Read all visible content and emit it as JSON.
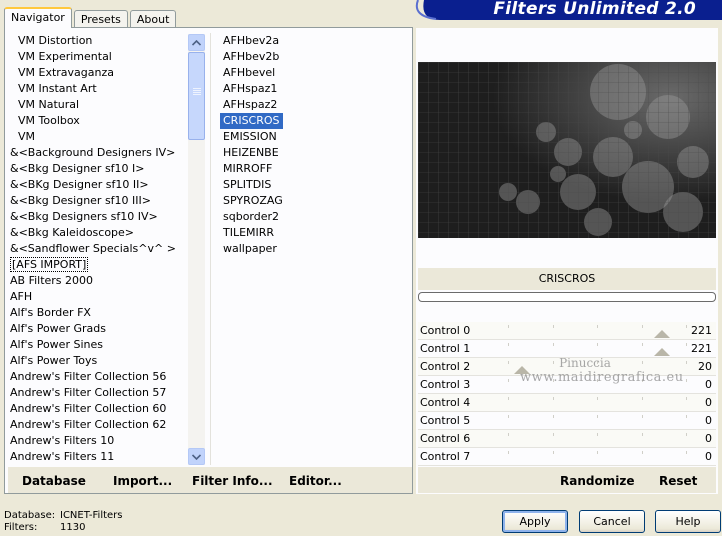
{
  "app": {
    "title": "Filters Unlimited 2.0"
  },
  "tabs": [
    {
      "label": "Navigator",
      "active": true
    },
    {
      "label": "Presets",
      "active": false
    },
    {
      "label": "About",
      "active": false
    }
  ],
  "categories": [
    {
      "label": "VM Distortion",
      "indent": true
    },
    {
      "label": "VM Experimental",
      "indent": true
    },
    {
      "label": "VM Extravaganza",
      "indent": true
    },
    {
      "label": "VM Instant Art",
      "indent": true
    },
    {
      "label": "VM Natural",
      "indent": true
    },
    {
      "label": "VM Toolbox",
      "indent": true
    },
    {
      "label": "VM",
      "indent": true
    },
    {
      "label": "&<Background Designers IV>",
      "indent": false
    },
    {
      "label": "&<Bkg Designer sf10 I>",
      "indent": false
    },
    {
      "label": "&<BKg Designer sf10 II>",
      "indent": false
    },
    {
      "label": "&<Bkg Designer sf10 III>",
      "indent": false
    },
    {
      "label": "&<Bkg Designers sf10 IV>",
      "indent": false
    },
    {
      "label": "&<Bkg Kaleidoscope>",
      "indent": false
    },
    {
      "label": "&<Sandflower Specials^v^ >",
      "indent": false
    },
    {
      "label": "[AFS IMPORT]",
      "indent": false,
      "selected": true
    },
    {
      "label": "AB Filters 2000",
      "indent": false
    },
    {
      "label": "AFH",
      "indent": false
    },
    {
      "label": "Alf's Border FX",
      "indent": false
    },
    {
      "label": "Alf's Power Grads",
      "indent": false
    },
    {
      "label": "Alf's Power Sines",
      "indent": false
    },
    {
      "label": "Alf's Power Toys",
      "indent": false
    },
    {
      "label": "Andrew's Filter Collection 56",
      "indent": false
    },
    {
      "label": "Andrew's Filter Collection 57",
      "indent": false
    },
    {
      "label": "Andrew's Filter Collection 60",
      "indent": false
    },
    {
      "label": "Andrew's Filter Collection 62",
      "indent": false
    },
    {
      "label": "Andrew's Filters 10",
      "indent": false
    },
    {
      "label": "Andrew's Filters 11",
      "indent": false
    }
  ],
  "filters": [
    {
      "label": "AFHbev2a"
    },
    {
      "label": "AFHbev2b"
    },
    {
      "label": "AFHbevel"
    },
    {
      "label": "AFHspaz1"
    },
    {
      "label": "AFHspaz2"
    },
    {
      "label": "CRISCROS",
      "selected": true
    },
    {
      "label": "EMISSION"
    },
    {
      "label": "HEIZENBE"
    },
    {
      "label": "MIRROFF"
    },
    {
      "label": "SPLITDIS"
    },
    {
      "label": "SPYROZAG"
    },
    {
      "label": "sqborder2"
    },
    {
      "label": "TILEMIRR"
    },
    {
      "label": "wallpaper"
    }
  ],
  "panel_buttons": {
    "database": "Database",
    "import": "Import...",
    "filter_info": "Filter Info...",
    "editor": "Editor..."
  },
  "selected_filter": "CRISCROS",
  "controls": [
    {
      "label": "Control 0",
      "value": "221",
      "level": 221,
      "max": 255
    },
    {
      "label": "Control 1",
      "value": "221",
      "level": 221,
      "max": 255
    },
    {
      "label": "Control 2",
      "value": "20",
      "level": 20,
      "max": 255
    },
    {
      "label": "Control 3",
      "value": "0",
      "level": 0,
      "max": 255
    },
    {
      "label": "Control 4",
      "value": "0",
      "level": 0,
      "max": 255
    },
    {
      "label": "Control 5",
      "value": "0",
      "level": 0,
      "max": 255
    },
    {
      "label": "Control 6",
      "value": "0",
      "level": 0,
      "max": 255
    },
    {
      "label": "Control 7",
      "value": "0",
      "level": 0,
      "max": 255
    }
  ],
  "right_buttons": {
    "randomize": "Randomize",
    "reset": "Reset"
  },
  "watermark": {
    "line1": "Pinuccia",
    "line2": "www.maidiregrafica.eu"
  },
  "status": {
    "database_label": "Database:",
    "database_value": "ICNET-Filters",
    "filters_label": "Filters:",
    "filters_value": "1130"
  },
  "dialog_buttons": {
    "apply": "Apply",
    "cancel": "Cancel",
    "help": "Help"
  },
  "colors": {
    "banner": "#0a1f8f",
    "selection": "#316ac5",
    "tab_highlight": "#ffc83c"
  }
}
